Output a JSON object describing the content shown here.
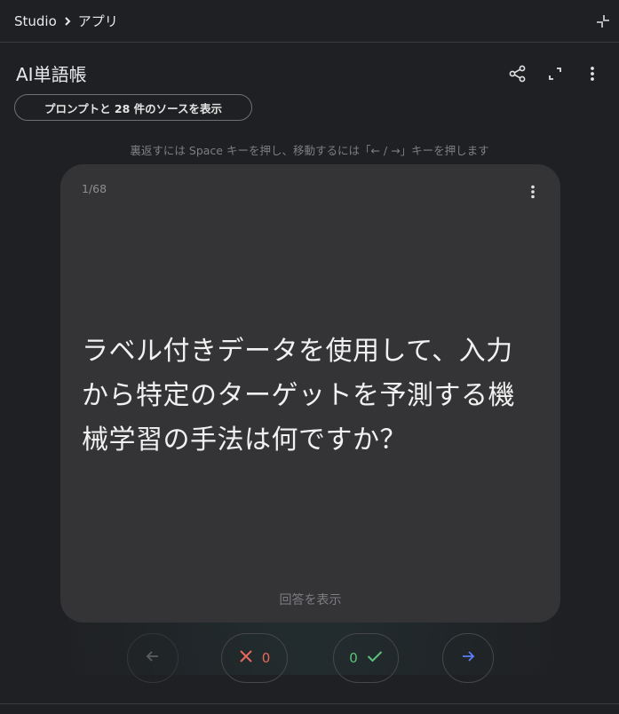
{
  "breadcrumb": {
    "root": "Studio",
    "current": "アプリ"
  },
  "header": {
    "title": "AI単語帳",
    "share_icon": "share-icon",
    "expand_icon": "fullscreen-icon",
    "menu_icon": "more-vert-icon"
  },
  "sources_button": {
    "label": "プロンプトと 28 件のソースを表示"
  },
  "hint": "裏返すには Space キーを押し、移動するには「← / →」キーを押します",
  "card": {
    "counter": "1/68",
    "question": "ラベル付きデータを使用して、入力から特定のターゲットを予測する機械学習の手法は何ですか？",
    "reveal_label": "回答を表示"
  },
  "controls": {
    "incorrect_count": "0",
    "correct_count": "0"
  },
  "colors": {
    "background": "#1f2023",
    "card": "#343436",
    "incorrect": "#e66a5c",
    "correct": "#5bc47a",
    "next_arrow": "#5b7ef5"
  }
}
